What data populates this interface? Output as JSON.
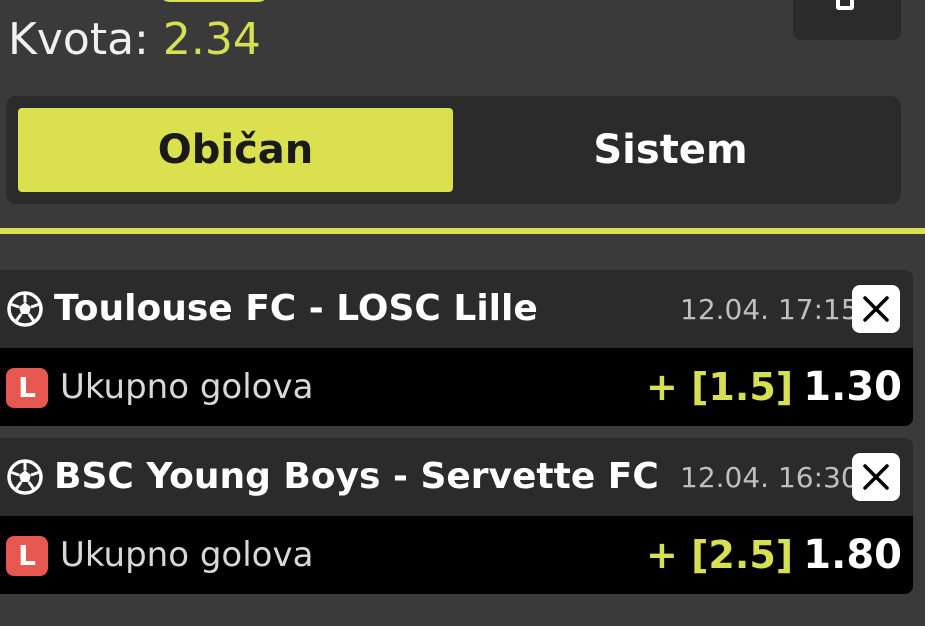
{
  "ticket": {
    "odds_label": "Kvota: ",
    "odds_value": "2.34"
  },
  "tabs": {
    "simple": "Običan",
    "system": "Sistem",
    "active": "simple"
  },
  "selections": [
    {
      "sport_icon": "soccer-ball-icon",
      "match": "Toulouse FC - LOSC Lille",
      "time": "12.04. 17:15",
      "live_badge": "L",
      "market": "Ukupno golova",
      "pick": "+ [1.5]",
      "odd": "1.30"
    },
    {
      "sport_icon": "soccer-ball-icon",
      "match": "BSC Young Boys - Servette FC",
      "time": "12.04. 16:30",
      "live_badge": "L",
      "market": "Ukupno golova",
      "pick": "+ [2.5]",
      "odd": "1.80"
    }
  ],
  "colors": {
    "accent": "#dbe04e",
    "background": "#3a3a3a",
    "panel": "#2b2b2b",
    "row": "#000000",
    "live_badge": "#e5574f"
  }
}
